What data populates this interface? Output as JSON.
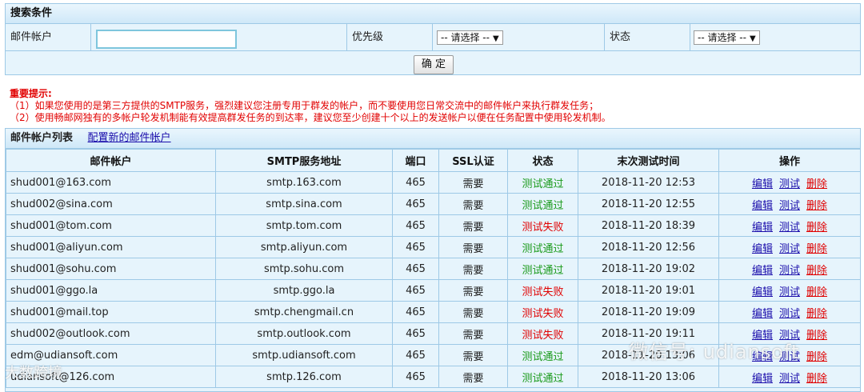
{
  "search": {
    "title": "搜索条件",
    "account_label": "邮件帐户",
    "account_value": "",
    "priority_label": "优先级",
    "priority_selected": "-- 请选择 --",
    "status_label": "状态",
    "status_selected": "-- 请选择 --",
    "confirm_label": "确 定"
  },
  "tips": {
    "title": "重要提示:",
    "line1": "（1）如果您使用的是第三方提供的SMTP服务，强烈建议您注册专用于群发的帐户，而不要使用您日常交流中的邮件帐户来执行群发任务；",
    "line2": "（2）使用畅邮网独有的多帐户轮发机制能有效提高群发任务的到达率，建议您至少创建十个以上的发送帐户以便在任务配置中使用轮发机制。"
  },
  "list": {
    "title": "邮件帐户列表",
    "add_link": "配置新的邮件帐户",
    "columns": [
      "邮件帐户",
      "SMTP服务地址",
      "端口",
      "SSL认证",
      "状态",
      "末次测试时间",
      "操作"
    ],
    "ops": {
      "edit": "编辑",
      "test": "测试",
      "delete": "删除"
    },
    "rows": [
      {
        "account": "shud001@163.com",
        "smtp": "smtp.163.com",
        "port": "465",
        "ssl": "需要",
        "status": "测试通过",
        "ok": true,
        "time": "2018-11-20 12:53"
      },
      {
        "account": "shud002@sina.com",
        "smtp": "smtp.sina.com",
        "port": "465",
        "ssl": "需要",
        "status": "测试通过",
        "ok": true,
        "time": "2018-11-20 12:55"
      },
      {
        "account": "shud001@tom.com",
        "smtp": "smtp.tom.com",
        "port": "465",
        "ssl": "需要",
        "status": "测试失败",
        "ok": false,
        "time": "2018-11-20 18:39"
      },
      {
        "account": "shud001@aliyun.com",
        "smtp": "smtp.aliyun.com",
        "port": "465",
        "ssl": "需要",
        "status": "测试通过",
        "ok": true,
        "time": "2018-11-20 12:56"
      },
      {
        "account": "shud001@sohu.com",
        "smtp": "smtp.sohu.com",
        "port": "465",
        "ssl": "需要",
        "status": "测试通过",
        "ok": true,
        "time": "2018-11-20 19:02"
      },
      {
        "account": "shud001@ggo.la",
        "smtp": "smtp.ggo.la",
        "port": "465",
        "ssl": "需要",
        "status": "测试失败",
        "ok": false,
        "time": "2018-11-20 19:01"
      },
      {
        "account": "shud001@mail.top",
        "smtp": "smtp.chengmail.cn",
        "port": "465",
        "ssl": "需要",
        "status": "测试失败",
        "ok": false,
        "time": "2018-11-20 19:09"
      },
      {
        "account": "shud002@outlook.com",
        "smtp": "smtp.outlook.com",
        "port": "465",
        "ssl": "需要",
        "status": "测试失败",
        "ok": false,
        "time": "2018-11-20 19:11"
      },
      {
        "account": "edm@udiansoft.com",
        "smtp": "smtp.udiansoft.com",
        "port": "465",
        "ssl": "需要",
        "status": "测试通过",
        "ok": true,
        "time": "2018-11-20 13:06"
      },
      {
        "account": "udiansoft@126.com",
        "smtp": "smtp.126.com",
        "port": "465",
        "ssl": "需要",
        "status": "测试通过",
        "ok": true,
        "time": "2018-11-20 13:06"
      }
    ]
  },
  "watermark": {
    "wechat": "微信号: udiansoft",
    "brand": "大数跨境"
  },
  "colors": {
    "pass": "#1a9a1a",
    "fail": "#e00000",
    "link": "#1a0dab",
    "border": "#9ec9e6",
    "panel_bg": "#e6f4fc"
  }
}
